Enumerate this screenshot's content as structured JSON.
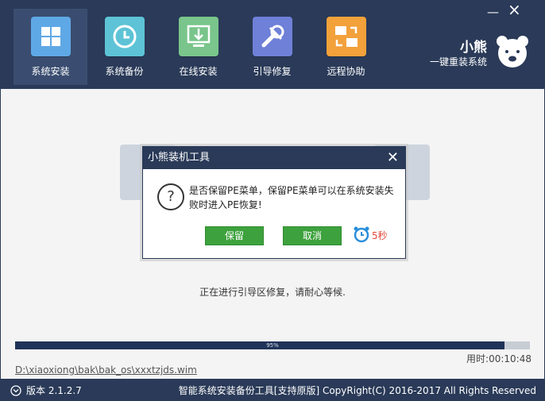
{
  "nav": [
    {
      "label": "系统安装"
    },
    {
      "label": "系统备份"
    },
    {
      "label": "在线安装"
    },
    {
      "label": "引导修复"
    },
    {
      "label": "远程协助"
    }
  ],
  "brand": {
    "title": "小熊",
    "subtitle": "一键重装系统"
  },
  "status_text": "正在进行引导区修复，请耐心等候.",
  "progress": {
    "value": 0.95,
    "label": "95%"
  },
  "elapsed": "用时:00:10:48",
  "file_path": "D:\\xiaoxiong\\bak\\bak_os\\xxxtzjds.wim",
  "footer": {
    "version": "版本 2.1.2.7",
    "copyright": "智能系统安装备份工具[支持原版]  CopyRight(C) 2016-2017 All Rights Reserved"
  },
  "dialog": {
    "title": "小熊装机工具",
    "message": "是否保留PE菜单，保留PE菜单可以在系统安装失败时进入PE恢复!",
    "keep_button": "保留",
    "cancel_button": "取消",
    "countdown": "5秒"
  },
  "colors": {
    "header": "#2a3a58",
    "accent_green": "#3da23d",
    "countdown_red": "#e24a3b"
  }
}
